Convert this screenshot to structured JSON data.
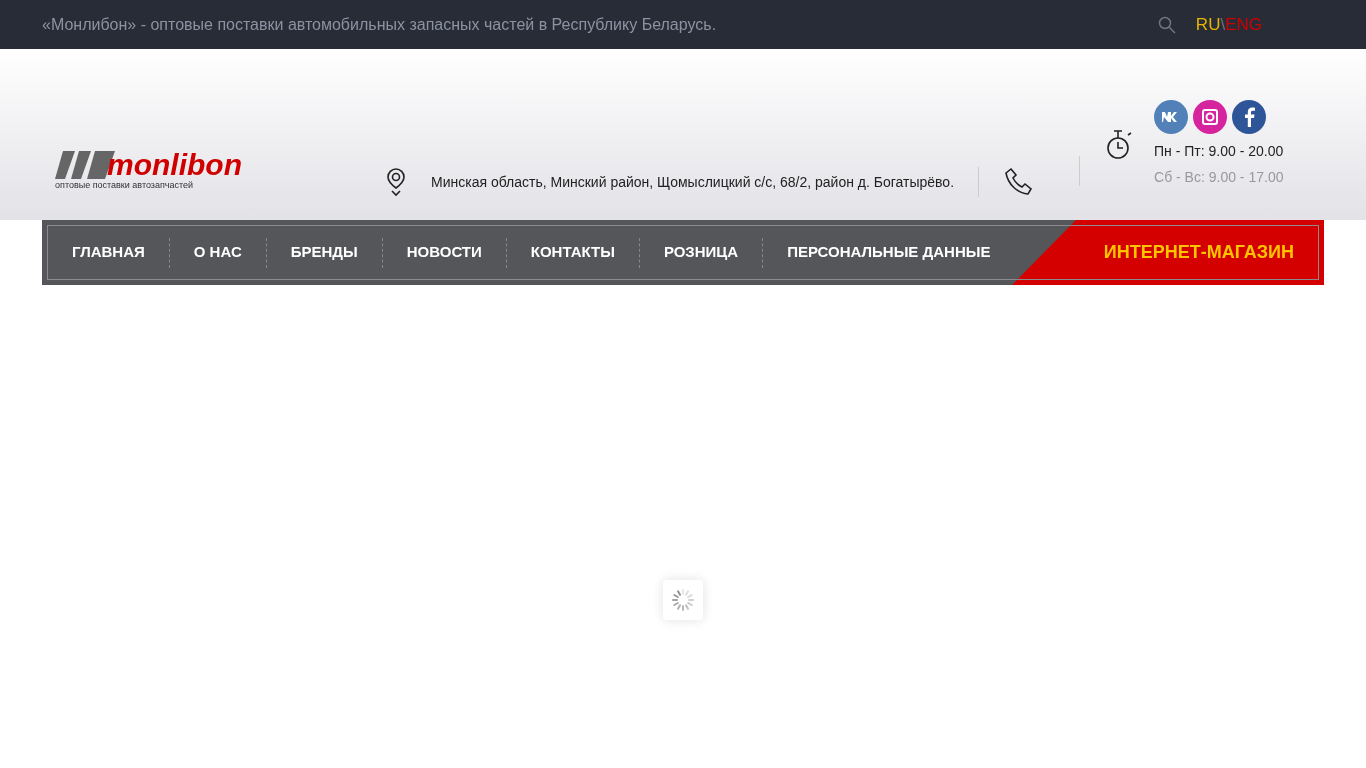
{
  "top_bar": {
    "tagline": "«Монлибон» - оптовые поставки автомобильных запасных частей в Республику Беларусь.",
    "languages": [
      {
        "label": "RU",
        "selected": true
      },
      {
        "label": "ENG",
        "selected": false
      }
    ],
    "language_separator": "\\"
  },
  "logo": {
    "name": "monlibon",
    "subtitle": "оптовые поставки автозапчастей"
  },
  "address": "Минская область, Минский район, Щомыслицкий с/с, 68/2, район д. Богатырёво.",
  "hours": [
    "Пн - Пт: 9.00 - 20.00",
    "Сб - Вс: 9.00 - 17.00"
  ],
  "social": [
    {
      "kind": "vk",
      "color": "#5181b8"
    },
    {
      "kind": "instagram",
      "color": "#d6249f"
    },
    {
      "kind": "facebook",
      "color": "#2d5597"
    }
  ],
  "nav": {
    "items": [
      "ГЛАВНАЯ",
      "О НАС",
      "БРЕНДЫ",
      "НОВОСТИ",
      "КОНТАКТЫ",
      "РОЗНИЦА",
      "ПЕРСОНАЛЬНЫЕ ДАННЫЕ"
    ],
    "shop": "ИНТЕРНЕТ-МАГАЗИН"
  }
}
